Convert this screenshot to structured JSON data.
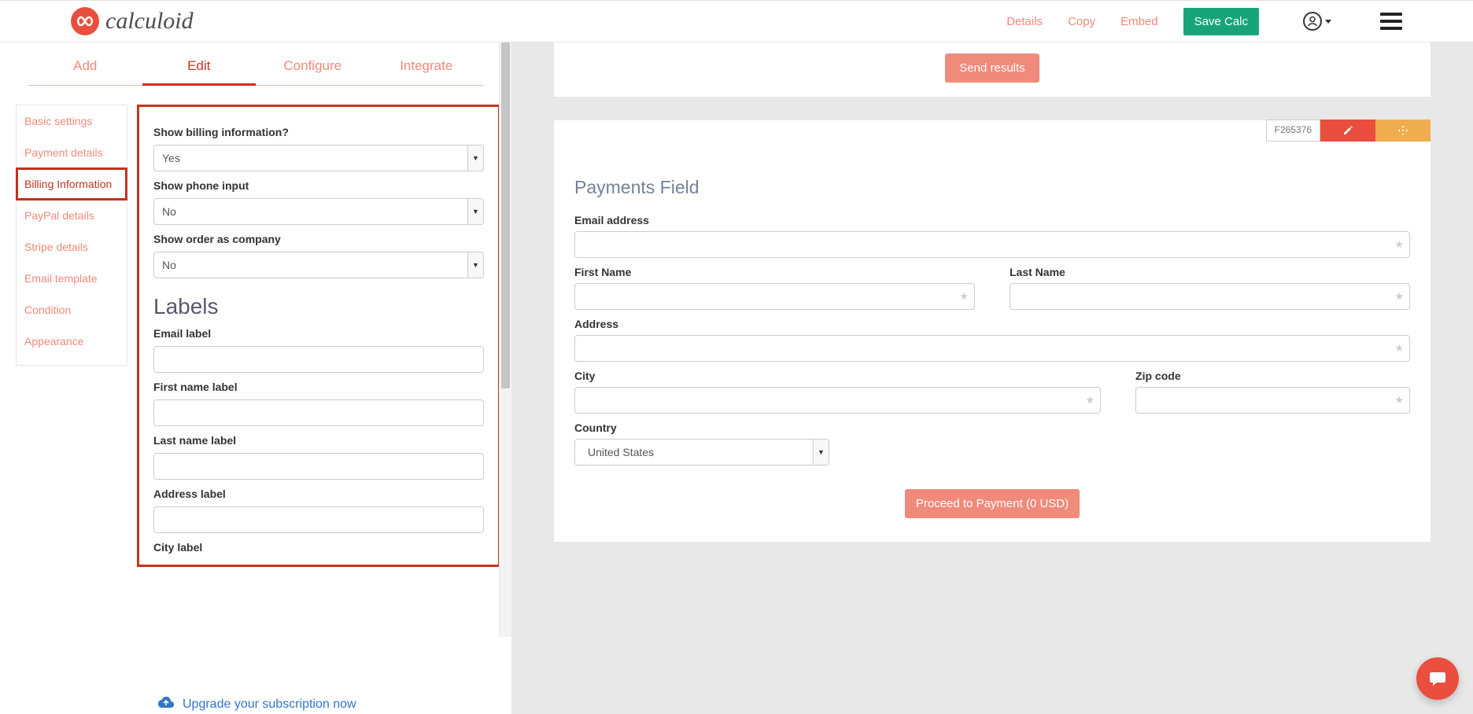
{
  "brand": "calculoid",
  "top_links": {
    "details": "Details",
    "copy": "Copy",
    "embed": "Embed"
  },
  "save_button": "Save Calc",
  "tabs": {
    "add": "Add",
    "edit": "Edit",
    "configure": "Configure",
    "integrate": "Integrate"
  },
  "sidebar": {
    "basic": "Basic settings",
    "payment": "Payment details",
    "billing": "Billing Information",
    "paypal": "PayPal details",
    "stripe": "Stripe details",
    "email": "Email template",
    "condition": "Condition",
    "appearance": "Appearance"
  },
  "form": {
    "show_billing_label": "Show billing information?",
    "show_billing_value": "Yes",
    "show_phone_label": "Show phone input",
    "show_phone_value": "No",
    "show_company_label": "Show order as company",
    "show_company_value": "No",
    "labels_heading": "Labels",
    "email_label": "Email label",
    "first_name_label": "First name label",
    "last_name_label": "Last name label",
    "address_label": "Address label",
    "city_label": "City label"
  },
  "upgrade_text": "Upgrade your subscription now",
  "preview": {
    "send_results": "Send results",
    "field_id": "F265376",
    "title": "Payments Field",
    "email": "Email address",
    "first_name": "First Name",
    "last_name": "Last Name",
    "address": "Address",
    "city": "City",
    "zip": "Zip code",
    "country_label": "Country",
    "country_value": "United States",
    "proceed": "Proceed to Payment (0 USD)"
  }
}
